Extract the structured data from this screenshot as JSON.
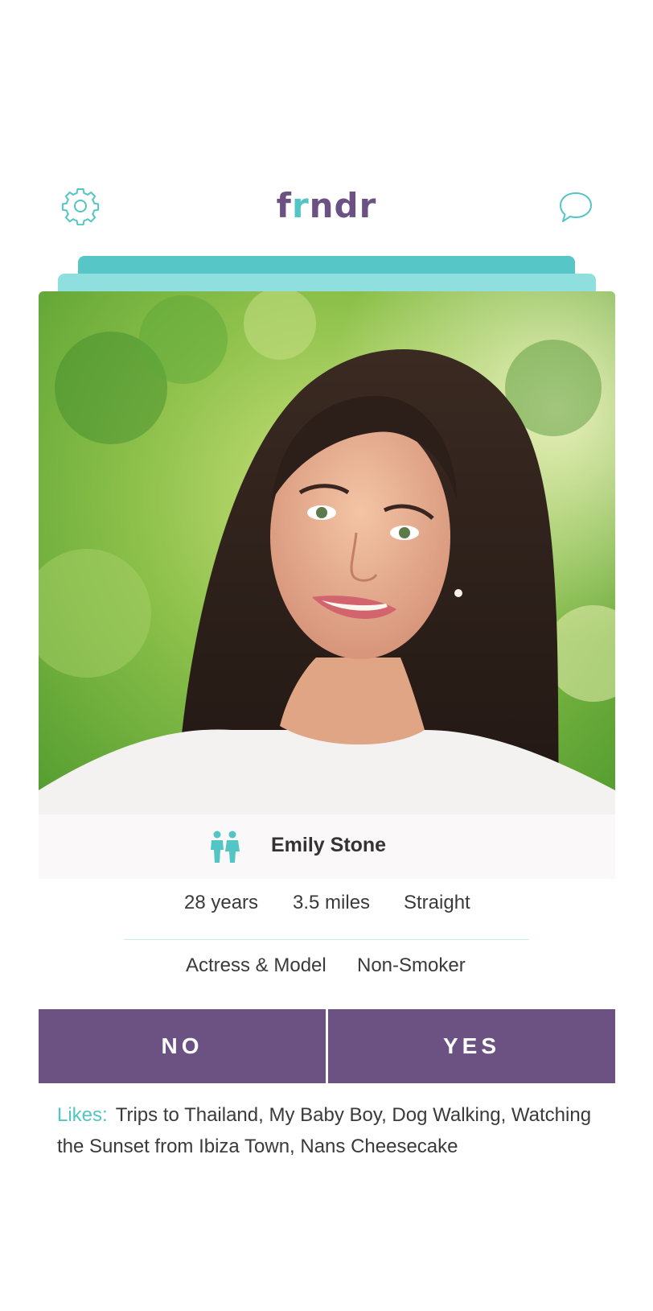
{
  "app": {
    "logo_prefix": "f",
    "logo_accent": "r",
    "logo_suffix": "ndr"
  },
  "profile": {
    "name": "Emily Stone",
    "age": "28 years",
    "distance": "3.5 miles",
    "orientation": "Straight",
    "occupation": "Actress & Model",
    "smoking": "Non-Smoker",
    "likes_label": "Likes:",
    "likes": "Trips to Thailand, My Baby Boy, Dog Walking, Watching the Sunset from Ibiza Town, Nans Cheesecake"
  },
  "actions": {
    "no_label": "NO",
    "yes_label": "YES"
  },
  "icons": {
    "settings": "gear-icon",
    "chat": "chat-bubble-icon",
    "gender": "couple-icon"
  },
  "colors": {
    "brand_purple": "#6b5282",
    "accent_teal": "#52c5c4",
    "stack_teal": "#57c6c6",
    "stack_light_teal": "#8fdfde"
  }
}
